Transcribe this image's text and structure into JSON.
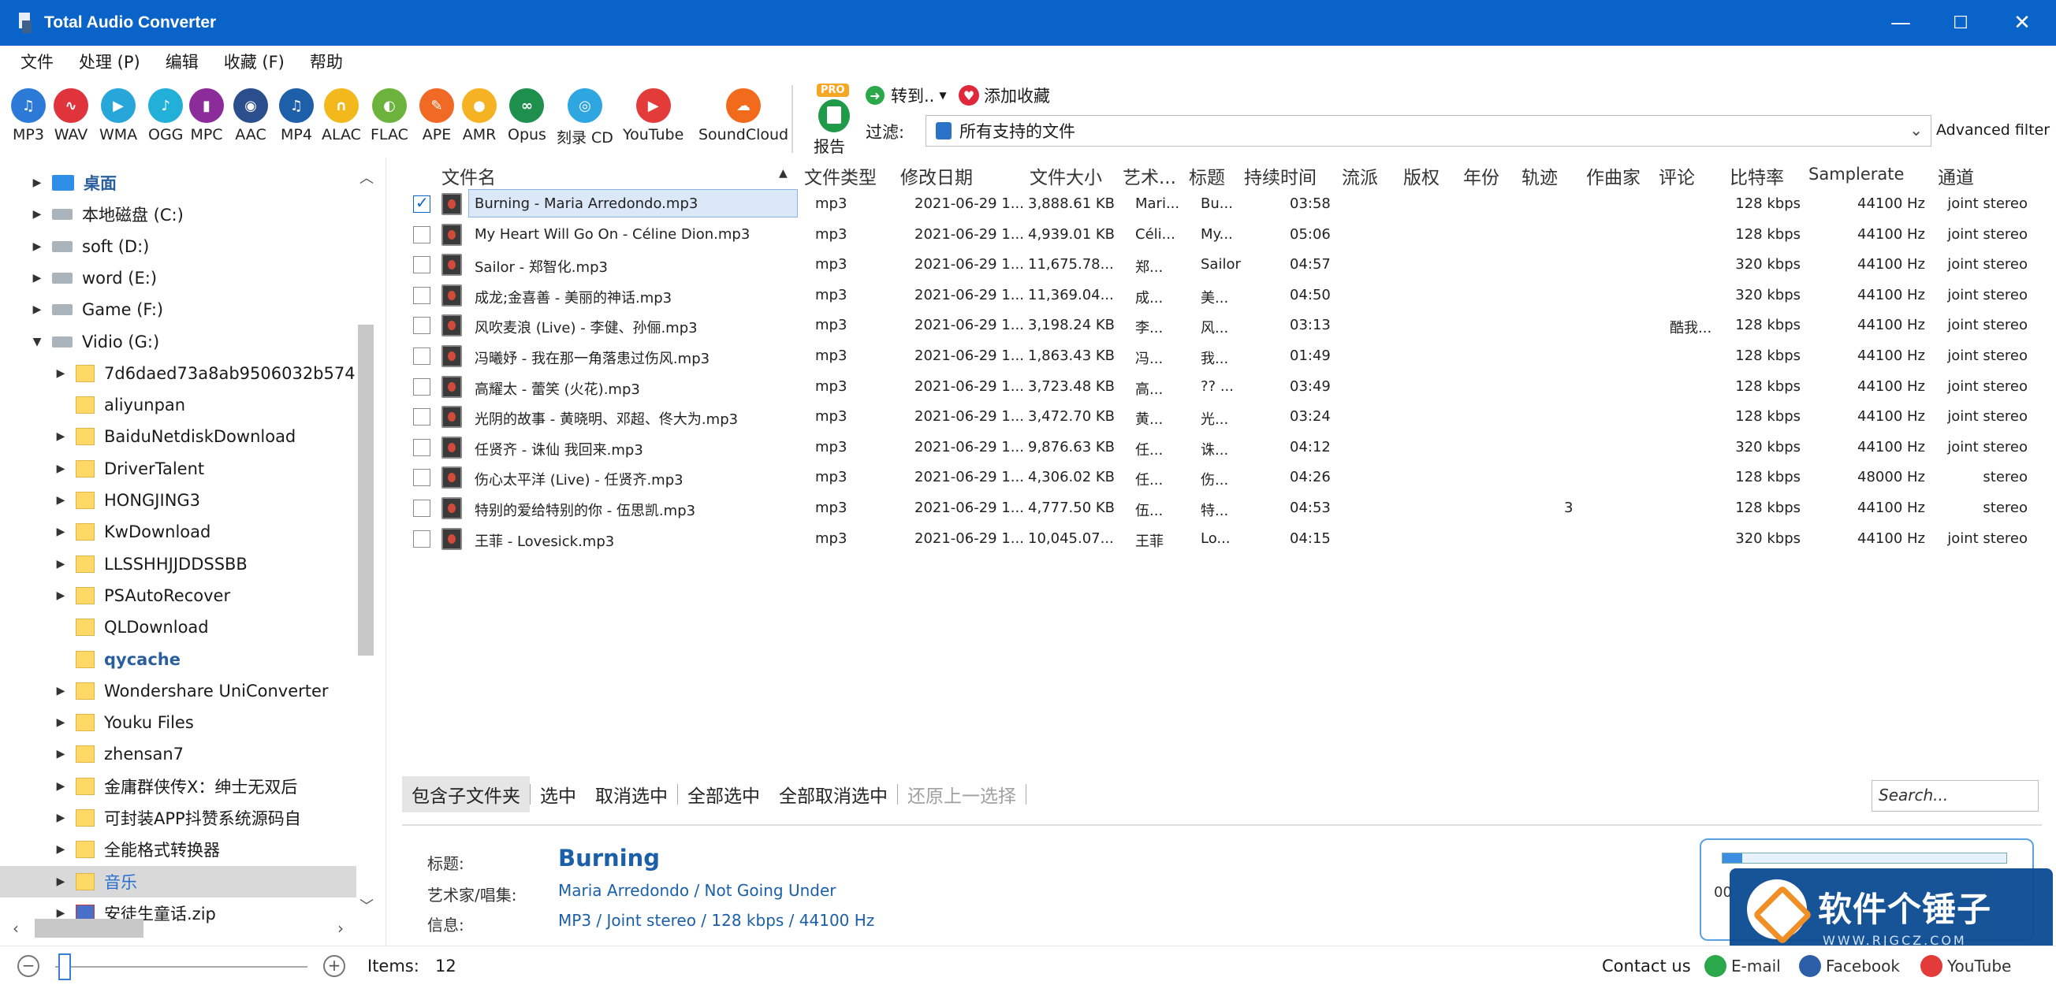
{
  "window": {
    "title": "Total Audio Converter",
    "minimize": "—",
    "maximize": "☐",
    "close": "✕"
  },
  "menu": [
    "文件",
    "处理 (P)",
    "编辑",
    "收藏 (F)",
    "帮助"
  ],
  "formats": [
    {
      "label": "MP3",
      "color": "#2b7ad8",
      "glyph": "♫"
    },
    {
      "label": "WAV",
      "color": "#e0343c",
      "glyph": "∿"
    },
    {
      "label": "WMA",
      "color": "#26a6d9",
      "glyph": "▶"
    },
    {
      "label": "OGG",
      "color": "#22b0d8",
      "glyph": "♪"
    },
    {
      "label": "MPC",
      "color": "#8c2b9a",
      "glyph": "▮"
    },
    {
      "label": "AAC",
      "color": "#2a4f8c",
      "glyph": "◉"
    },
    {
      "label": "MP4",
      "color": "#1d5fa8",
      "glyph": "♫"
    },
    {
      "label": "ALAC",
      "color": "#f2b81c",
      "glyph": "∩"
    },
    {
      "label": "FLAC",
      "color": "#6cb33e",
      "glyph": "◐"
    },
    {
      "label": "APE",
      "color": "#f06a25",
      "glyph": "✎"
    },
    {
      "label": "AMR",
      "color": "#f5b324",
      "glyph": "●"
    },
    {
      "label": "Opus",
      "color": "#1f8f4e",
      "glyph": "∞"
    },
    {
      "label": "刻录 CD",
      "color": "#2ea6e0",
      "glyph": "◎"
    },
    {
      "label": "YouTube",
      "color": "#e33a3a",
      "glyph": "▶"
    },
    {
      "label": "SoundCloud",
      "color": "#f26b1d",
      "glyph": "☁"
    }
  ],
  "report": {
    "badge": "PRO",
    "label": "报告"
  },
  "goto_label": "转到..",
  "fav_label": "添加收藏",
  "filter": {
    "label": "过滤:",
    "value": "所有支持的文件",
    "advanced": "Advanced filter"
  },
  "tree": [
    {
      "label": "桌面",
      "type": "desk",
      "indent": 0,
      "arrow": "▶",
      "bold": true
    },
    {
      "label": "本地磁盘 (C:)",
      "type": "drive",
      "indent": 0,
      "arrow": "▶"
    },
    {
      "label": "soft (D:)",
      "type": "drive",
      "indent": 0,
      "arrow": "▶"
    },
    {
      "label": "word (E:)",
      "type": "drive",
      "indent": 0,
      "arrow": "▶"
    },
    {
      "label": "Game (F:)",
      "type": "drive",
      "indent": 0,
      "arrow": "▶"
    },
    {
      "label": "Vidio (G:)",
      "type": "drive",
      "indent": 0,
      "arrow": "▼"
    },
    {
      "label": "7d6daed73a8ab9506032b574",
      "type": "folder",
      "indent": 1,
      "arrow": "▶"
    },
    {
      "label": "aliyunpan",
      "type": "folder",
      "indent": 1,
      "arrow": ""
    },
    {
      "label": "BaiduNetdiskDownload",
      "type": "folder",
      "indent": 1,
      "arrow": "▶"
    },
    {
      "label": "DriverTalent",
      "type": "folder",
      "indent": 1,
      "arrow": "▶"
    },
    {
      "label": "HONGJING3",
      "type": "folder",
      "indent": 1,
      "arrow": "▶"
    },
    {
      "label": "KwDownload",
      "type": "folder",
      "indent": 1,
      "arrow": "▶"
    },
    {
      "label": "LLSSHHJJDDSSBB",
      "type": "folder",
      "indent": 1,
      "arrow": "▶"
    },
    {
      "label": "PSAutoRecover",
      "type": "folder",
      "indent": 1,
      "arrow": "▶"
    },
    {
      "label": "QLDownload",
      "type": "folder",
      "indent": 1,
      "arrow": ""
    },
    {
      "label": "qycache",
      "type": "folder",
      "indent": 1,
      "arrow": "",
      "bold": true
    },
    {
      "label": "Wondershare UniConverter",
      "type": "folder",
      "indent": 1,
      "arrow": "▶"
    },
    {
      "label": "Youku Files",
      "type": "folder",
      "indent": 1,
      "arrow": "▶"
    },
    {
      "label": "zhensan7",
      "type": "folder",
      "indent": 1,
      "arrow": "▶"
    },
    {
      "label": "金庸群侠传X：绅士无双后",
      "type": "folder",
      "indent": 1,
      "arrow": "▶"
    },
    {
      "label": "可封装APP抖赞系统源码自",
      "type": "folder",
      "indent": 1,
      "arrow": "▶"
    },
    {
      "label": "全能格式转换器",
      "type": "folder",
      "indent": 1,
      "arrow": "▶"
    },
    {
      "label": "音乐",
      "type": "music",
      "indent": 1,
      "arrow": "▶",
      "selected": true
    },
    {
      "label": "安徒生童话.zip",
      "type": "zip",
      "indent": 1,
      "arrow": "▶"
    }
  ],
  "columns": [
    "文件名",
    "文件类型",
    "修改日期",
    "文件大小",
    "艺术...",
    "标题",
    "持续时间",
    "流派",
    "版权",
    "年份",
    "轨迹",
    "作曲家",
    "评论",
    "比特率",
    "Samplerate",
    "通道"
  ],
  "rows": [
    {
      "name": "Burning - Maria Arredondo.mp3",
      "type": "mp3",
      "date": "2021-06-29 1...",
      "size": "3,888.61 KB",
      "artist": "Mari...",
      "title": "Bu...",
      "dur": "03:58",
      "track": "",
      "composer": "",
      "bitrate": "128 kbps",
      "sr": "44100 Hz",
      "ch": "joint stereo",
      "checked": true,
      "selected": true
    },
    {
      "name": "My Heart Will Go On - Céline Dion.mp3",
      "type": "mp3",
      "date": "2021-06-29 1...",
      "size": "4,939.01 KB",
      "artist": "Céli...",
      "title": "My...",
      "dur": "05:06",
      "track": "",
      "composer": "",
      "bitrate": "128 kbps",
      "sr": "44100 Hz",
      "ch": "joint stereo"
    },
    {
      "name": "Sailor - 郑智化.mp3",
      "type": "mp3",
      "date": "2021-06-29 1...",
      "size": "11,675.78...",
      "artist": "郑...",
      "title": "Sailor",
      "dur": "04:57",
      "track": "",
      "composer": "",
      "bitrate": "320 kbps",
      "sr": "44100 Hz",
      "ch": "joint stereo"
    },
    {
      "name": "成龙;金喜善 - 美丽的神话.mp3",
      "type": "mp3",
      "date": "2021-06-29 1...",
      "size": "11,369.04...",
      "artist": "成...",
      "title": "美...",
      "dur": "04:50",
      "track": "",
      "composer": "",
      "bitrate": "320 kbps",
      "sr": "44100 Hz",
      "ch": "joint stereo"
    },
    {
      "name": "风吹麦浪 (Live) - 李健、孙俪.mp3",
      "type": "mp3",
      "date": "2021-06-29 1...",
      "size": "3,198.24 KB",
      "artist": "李...",
      "title": "风...",
      "dur": "03:13",
      "track": "",
      "composer": "酷我...",
      "bitrate": "128 kbps",
      "sr": "44100 Hz",
      "ch": "joint stereo"
    },
    {
      "name": "冯曦妤 - 我在那一角落患过伤风.mp3",
      "type": "mp3",
      "date": "2021-06-29 1...",
      "size": "1,863.43 KB",
      "artist": "冯...",
      "title": "我...",
      "dur": "01:49",
      "track": "",
      "composer": "",
      "bitrate": "128 kbps",
      "sr": "44100 Hz",
      "ch": "joint stereo"
    },
    {
      "name": "高耀太 - 蕾笑 (火花).mp3",
      "type": "mp3",
      "date": "2021-06-29 1...",
      "size": "3,723.48 KB",
      "artist": "高...",
      "title": "?? ...",
      "dur": "03:49",
      "track": "",
      "composer": "",
      "bitrate": "128 kbps",
      "sr": "44100 Hz",
      "ch": "joint stereo"
    },
    {
      "name": "光阴的故事 - 黄晓明、邓超、佟大为.mp3",
      "type": "mp3",
      "date": "2021-06-29 1...",
      "size": "3,472.70 KB",
      "artist": "黄...",
      "title": "光...",
      "dur": "03:24",
      "track": "",
      "composer": "",
      "bitrate": "128 kbps",
      "sr": "44100 Hz",
      "ch": "joint stereo"
    },
    {
      "name": "任贤齐 - 诛仙 我回来.mp3",
      "type": "mp3",
      "date": "2021-06-29 1...",
      "size": "9,876.63 KB",
      "artist": "任...",
      "title": "诛...",
      "dur": "04:12",
      "track": "",
      "composer": "",
      "bitrate": "320 kbps",
      "sr": "44100 Hz",
      "ch": "joint stereo"
    },
    {
      "name": "伤心太平洋 (Live) - 任贤齐.mp3",
      "type": "mp3",
      "date": "2021-06-29 1...",
      "size": "4,306.02 KB",
      "artist": "任...",
      "title": "伤...",
      "dur": "04:26",
      "track": "",
      "composer": "",
      "bitrate": "128 kbps",
      "sr": "48000 Hz",
      "ch": "stereo"
    },
    {
      "name": "特别的爱给特别的你 - 伍思凯.mp3",
      "type": "mp3",
      "date": "2021-06-29 1...",
      "size": "4,777.50 KB",
      "artist": "伍...",
      "title": "特...",
      "dur": "04:53",
      "track": "3",
      "composer": "",
      "bitrate": "128 kbps",
      "sr": "44100 Hz",
      "ch": "stereo"
    },
    {
      "name": "王菲 - Lovesick.mp3",
      "type": "mp3",
      "date": "2021-06-29 1...",
      "size": "10,045.07...",
      "artist": "王菲",
      "title": "Lo...",
      "dur": "04:15",
      "track": "",
      "composer": "",
      "bitrate": "320 kbps",
      "sr": "44100 Hz",
      "ch": "joint stereo"
    }
  ],
  "bottom_buttons": [
    "包含子文件夹",
    "选中",
    "取消选中",
    "全部选中",
    "全部取消选中",
    "还原上一选择"
  ],
  "search_placeholder": "Search...",
  "info": {
    "title_key": "标题:",
    "title_val": "Burning",
    "artist_key": "艺术家/唱集:",
    "artist_val": "Maria Arredondo / Not Going Under",
    "info_key": "信息:",
    "info_val": "MP3 / Joint stereo / 128 kbps / 44100 Hz"
  },
  "progress": {
    "fraction": 0.07,
    "text": "00"
  },
  "watermark": {
    "title": "软件个锤子",
    "url": "WWW.RJGCZ.COM"
  },
  "status": {
    "items_label": "Items:",
    "items_count": "12",
    "contact": "Contact us",
    "email": "E-mail",
    "facebook": "Facebook",
    "youtube": "YouTube"
  }
}
